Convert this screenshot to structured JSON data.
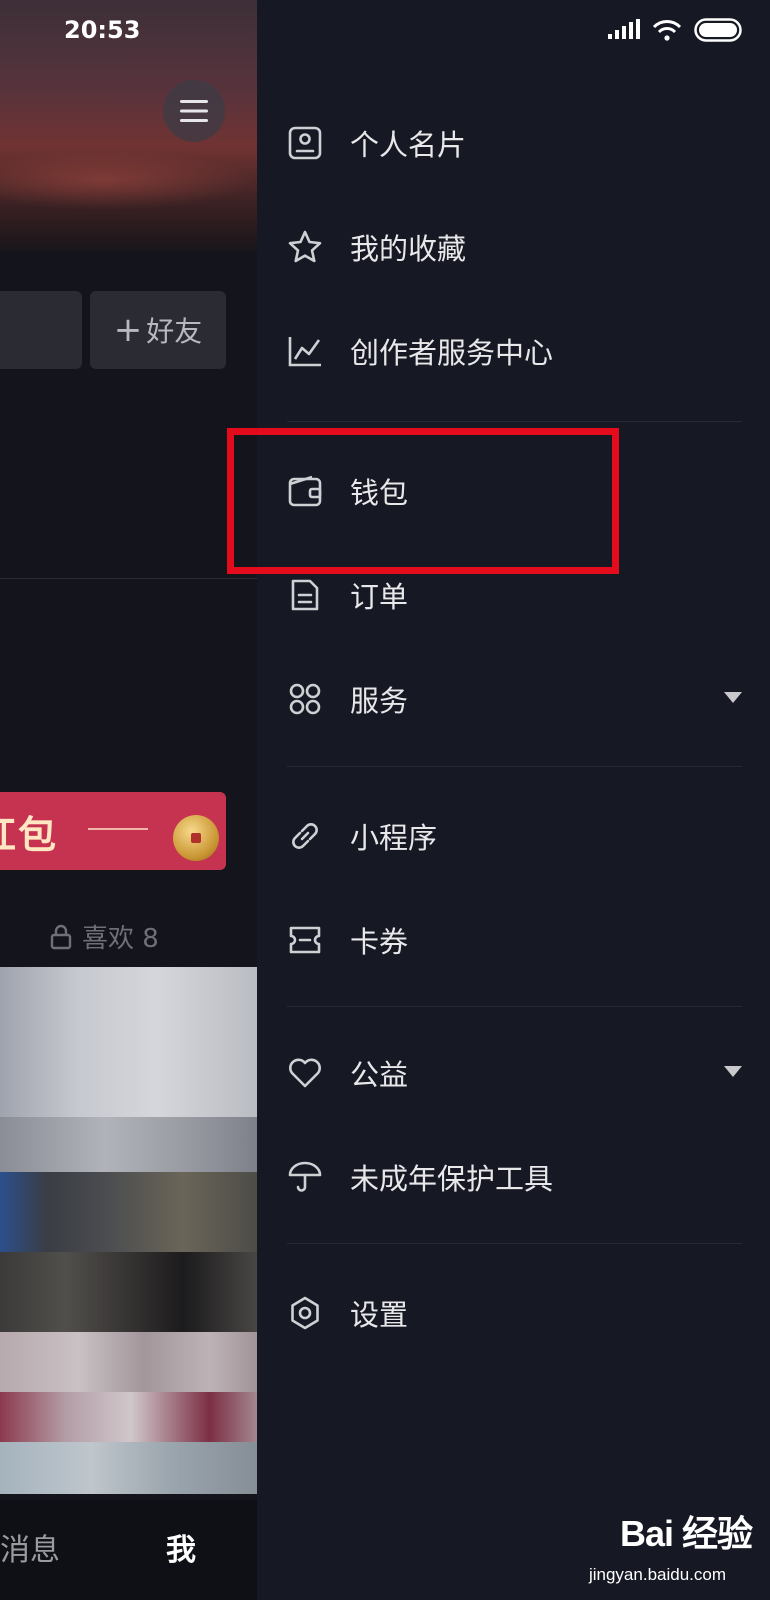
{
  "status_bar": {
    "time": "20:53"
  },
  "profile": {
    "add_friend_label": "好友",
    "banner_text": "红包",
    "likes_tab_label": "喜欢 8"
  },
  "bottom_nav": {
    "messages_label": "消息",
    "me_label": "我"
  },
  "drawer": {
    "groups": [
      [
        {
          "label": "个人名片",
          "icon": "id-card-icon"
        },
        {
          "label": "我的收藏",
          "icon": "star-icon"
        },
        {
          "label": "创作者服务中心",
          "icon": "chart-icon"
        }
      ],
      [
        {
          "label": "钱包",
          "icon": "wallet-icon",
          "highlighted": true
        },
        {
          "label": "订单",
          "icon": "order-icon"
        },
        {
          "label": "服务",
          "icon": "grid-icon",
          "expandable": true
        }
      ],
      [
        {
          "label": "小程序",
          "icon": "link-icon"
        },
        {
          "label": "卡券",
          "icon": "ticket-icon"
        }
      ],
      [
        {
          "label": "公益",
          "icon": "heart-icon",
          "expandable": true
        },
        {
          "label": "未成年保护工具",
          "icon": "umbrella-icon"
        }
      ],
      [
        {
          "label": "设置",
          "icon": "settings-icon"
        }
      ]
    ]
  },
  "watermark": {
    "logo": "Bai  经验",
    "site": "jingyan.baidu.com"
  },
  "colors": {
    "drawer_bg": "#161823",
    "highlight": "#e40b1d",
    "banner": "#c63350"
  }
}
